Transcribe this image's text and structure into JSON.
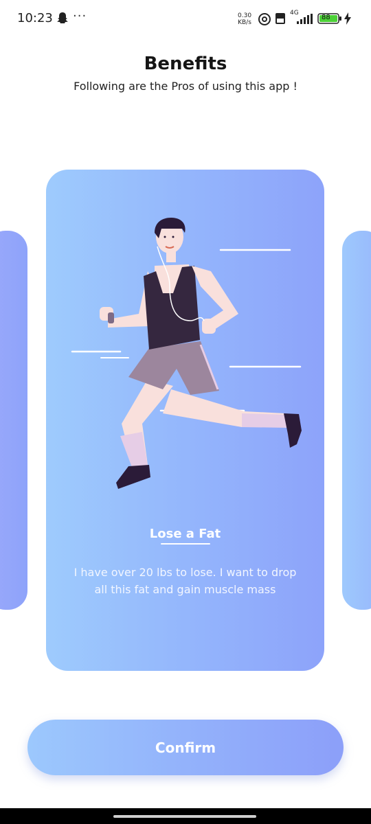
{
  "status_bar": {
    "time": "10:23",
    "more": "···",
    "speed_value": "0.30",
    "speed_unit": "KB/s",
    "network": "4G",
    "battery": "88"
  },
  "header": {
    "title": "Benefits",
    "subtitle": "Following are the Pros of using this app !"
  },
  "card": {
    "title": "Lose a Fat",
    "description": "I have over 20 lbs to lose. I want to drop all this fat and gain muscle mass"
  },
  "confirm_button": {
    "label": "Confirm"
  },
  "colors": {
    "gradient_start": "#9ecbfd",
    "gradient_end": "#8da3fa",
    "card_text": "#ffffff"
  }
}
